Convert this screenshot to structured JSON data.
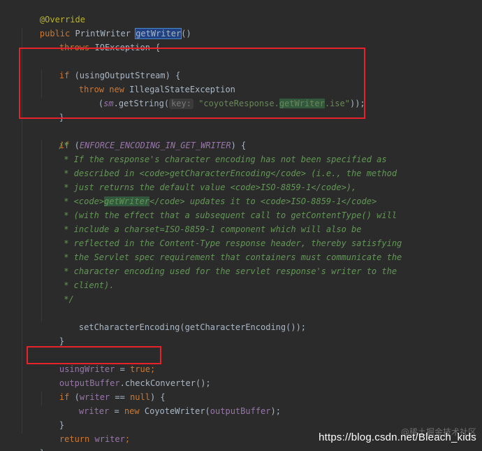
{
  "code": {
    "l1_annotation": "@Override",
    "l2_public": "public",
    "l2_type": " PrintWriter ",
    "l2_method": "getWriter",
    "l2_paren": "()",
    "l3_throws": "throws",
    "l3_rest": " IOException {",
    "l4_if": "if",
    "l4_rest": " (usingOutputStream) {",
    "l5_throw": "throw",
    "l5_sp": " ",
    "l5_new": "new",
    "l5_rest": " IllegalStateException",
    "l6_open": "(",
    "l6_sm": "sm",
    "l6_getstring": ".getString(",
    "l6_hint": "key:",
    "l6_str_a": " \"coyoteResponse.",
    "l6_str_hl": "getWriter",
    "l6_str_b": ".ise\"",
    "l6_close": "));",
    "l7_brace": "}",
    "l8_if": "if",
    "l8_open": " (",
    "l8_const": "ENFORCE_ENCODING_IN_GET_WRITER",
    "l8_close": ") {",
    "c1": "/*",
    "c2": " * If the response's character encoding has not been specified as",
    "c3": " * described in <code>getCharacterEncoding</code> (i.e., the method",
    "c4": " * just returns the default value <code>ISO-8859-1</code>),",
    "c5_a": " * <code>",
    "c5_hl": "getWriter",
    "c5_b": "</code> updates it to <code>ISO-8859-1</code>",
    "c6": " * (with the effect that a subsequent call to getContentType() will",
    "c7": " * include a charset=ISO-8859-1 component which will also be",
    "c8": " * reflected in the Content-Type response header, thereby satisfying",
    "c9": " * the Servlet spec requirement that containers must communicate the",
    "c10": " * character encoding used for the servlet response's writer to the",
    "c11": " * client).",
    "c12": " */",
    "l9": "setCharacterEncoding(getCharacterEncoding());",
    "l10_brace": "}",
    "l11_field": "usingWriter",
    "l11_eq": " = ",
    "l11_true": "true",
    "l11_semi": ";",
    "l12_field": "outputBuffer",
    "l12_rest": ".checkConverter();",
    "l13_if": "if",
    "l13_open": " (",
    "l13_field": "writer",
    "l13_eq": " == ",
    "l13_null": "null",
    "l13_close": ") {",
    "l14_field": "writer",
    "l14_eq": " = ",
    "l14_new": "new",
    "l14_ctor": " CoyoteWriter(",
    "l14_arg": "outputBuffer",
    "l14_close": ");",
    "l15_brace": "}",
    "l16_return": "return",
    "l16_sp": " ",
    "l16_field": "writer",
    "l16_semi": ";",
    "l17_brace": "}"
  },
  "watermark": {
    "top": "@稀土掘金技术社区",
    "url": "https://blog.csdn.net/Bleach_kids"
  },
  "colors": {
    "background": "#2b2b2b",
    "keyword": "#cc7832",
    "annotation": "#bbb529",
    "string": "#6a8759",
    "field": "#9876aa",
    "comment": "#629755",
    "text": "#a9b7c6",
    "highlight_box": "#e8222a"
  }
}
